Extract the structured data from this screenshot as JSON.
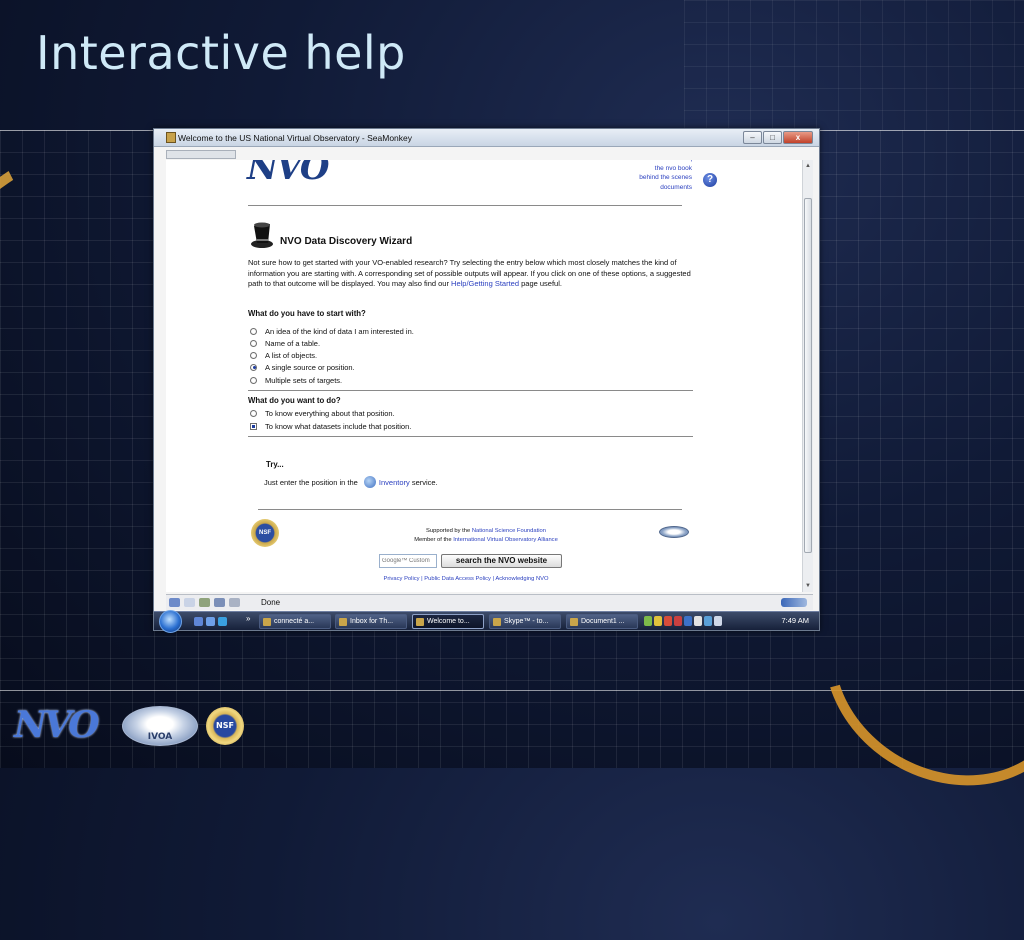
{
  "slide": {
    "title": "Interactive help"
  },
  "window": {
    "title": "Welcome to the US National Virtual Observatory - SeaMonkey",
    "controls": {
      "minimize": "–",
      "maximize": "□",
      "close": "x"
    }
  },
  "page": {
    "logo_text": "NVO",
    "top_links": [
      "faq",
      "the nvo book",
      "behind the scenes",
      "documents"
    ],
    "help_symbol": "?",
    "wizard_title": "NVO Data Discovery Wizard",
    "intro_before": "Not sure how to get started with your VO-enabled research? Try selecting the entry below which most closely matches the kind of information you are starting with. A corresponding set of possible outputs will appear. If you click on one of these options, a suggested path to that outcome will be displayed. You may also find our ",
    "intro_link": "Help/Getting Started",
    "intro_after": " page useful.",
    "q1": "What do you have to start with?",
    "start_options": [
      {
        "label": "An idea of the kind of data I am interested in.",
        "selected": false
      },
      {
        "label": "Name of a table.",
        "selected": false
      },
      {
        "label": "A list of objects.",
        "selected": false
      },
      {
        "label": "A single source or position.",
        "selected": true
      },
      {
        "label": "Multiple sets of targets.",
        "selected": false
      }
    ],
    "q2": "What do you want to do?",
    "want_options": [
      {
        "label": "To know everything about that position.",
        "selected": false
      },
      {
        "label": "To know what datasets include that position.",
        "selected": true
      }
    ],
    "try_title": "Try...",
    "try_before": "Just enter the position in the ",
    "try_link": "Inventory",
    "try_after": " service.",
    "nsf_seal_text": "NSF",
    "supported_by": "Supported by the ",
    "nsf_link": "National Science Foundation",
    "member_of": "Member of the ",
    "ivoa_link": "International Virtual Observatory Alliance",
    "google_placeholder": "Google™ Custom",
    "search_button": "search the NVO website",
    "policy_links": "Privacy Policy | Public Data Access Policy | Acknowledging NVO"
  },
  "status": {
    "text": "Done"
  },
  "taskbar": {
    "chevron": "»",
    "buttons": [
      "connecté a...",
      "Inbox for Th...",
      "Welcome to...",
      "Skype™ - to...",
      "Document1 ..."
    ],
    "active_index": 2,
    "clock": "7:49 AM"
  },
  "footer": {
    "nvo_logo": "NVO",
    "ivoa_logo": "IVOA",
    "nsf_logo": "NSF"
  },
  "colors": {
    "title": "#cfe9f7",
    "accent_gold": "#e2a73b",
    "link": "#2a3fbf"
  }
}
